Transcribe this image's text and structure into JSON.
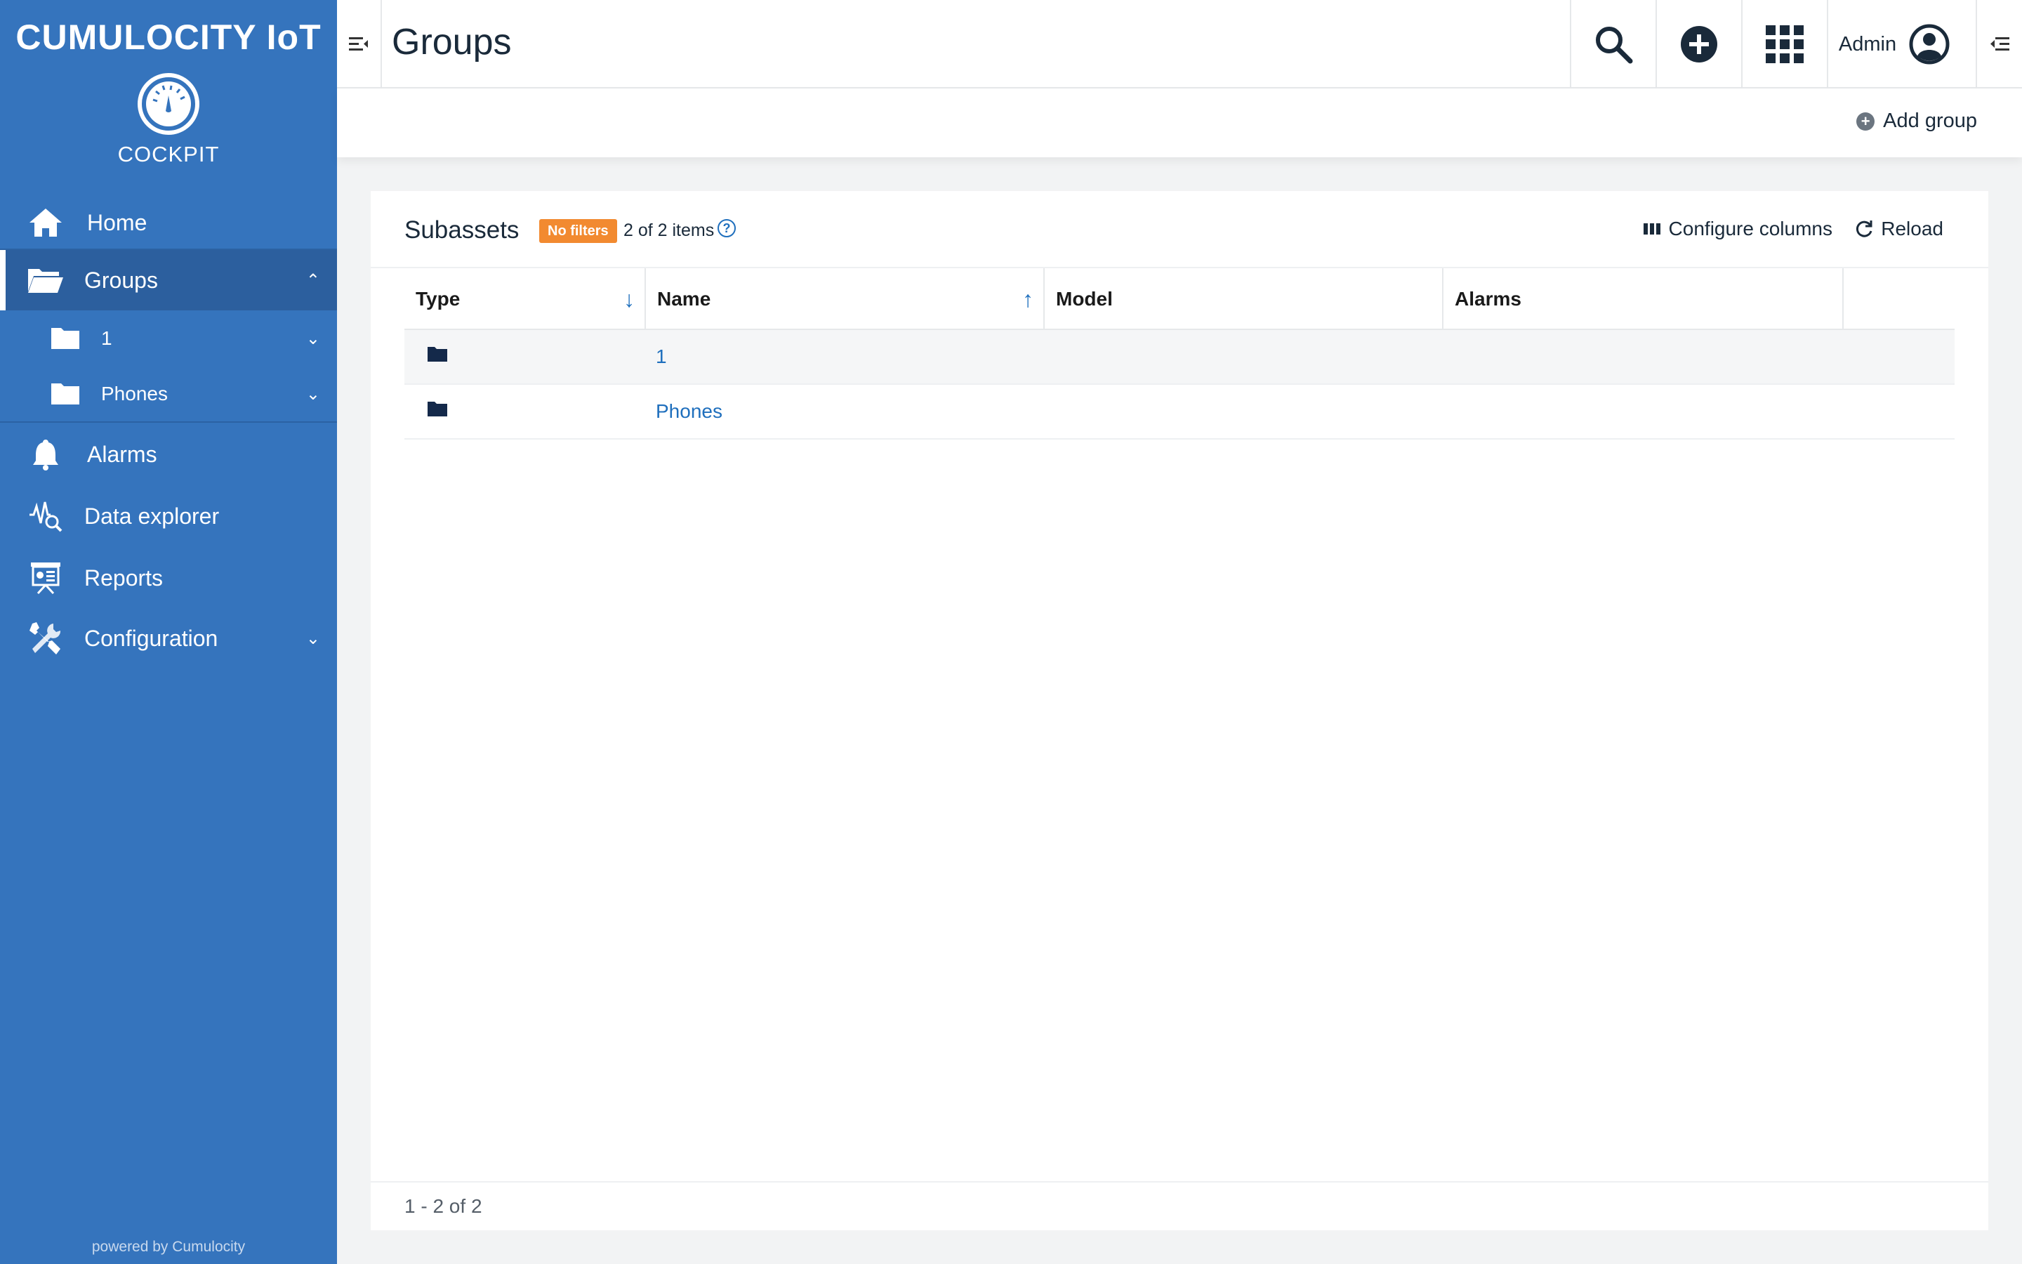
{
  "brand": {
    "title": "CUMULOCITY IoT",
    "app": "COCKPIT",
    "powered": "powered by Cumulocity"
  },
  "nav": {
    "home": "Home",
    "groups": "Groups",
    "group_children": [
      "1",
      "Phones"
    ],
    "alarms": "Alarms",
    "data_explorer": "Data explorer",
    "reports": "Reports",
    "configuration": "Configuration"
  },
  "header": {
    "title": "Groups",
    "user": "Admin"
  },
  "actions": {
    "add_group": "Add group"
  },
  "card": {
    "title": "Subassets",
    "filter_badge": "No filters",
    "count": "2 of 2 items",
    "configure_columns": "Configure columns",
    "reload": "Reload",
    "pager": "1 - 2 of 2"
  },
  "table": {
    "columns": [
      "Type",
      "Name",
      "Model",
      "Alarms"
    ],
    "rows": [
      {
        "type": "folder-icon",
        "name": "1",
        "model": "",
        "alarms": ""
      },
      {
        "type": "folder-icon",
        "name": "Phones",
        "model": "",
        "alarms": ""
      }
    ]
  },
  "colors": {
    "sidebar": "#3574bd",
    "sidebar_active": "#2c5f9e",
    "link": "#1f6fbd",
    "badge": "#f28a30"
  }
}
